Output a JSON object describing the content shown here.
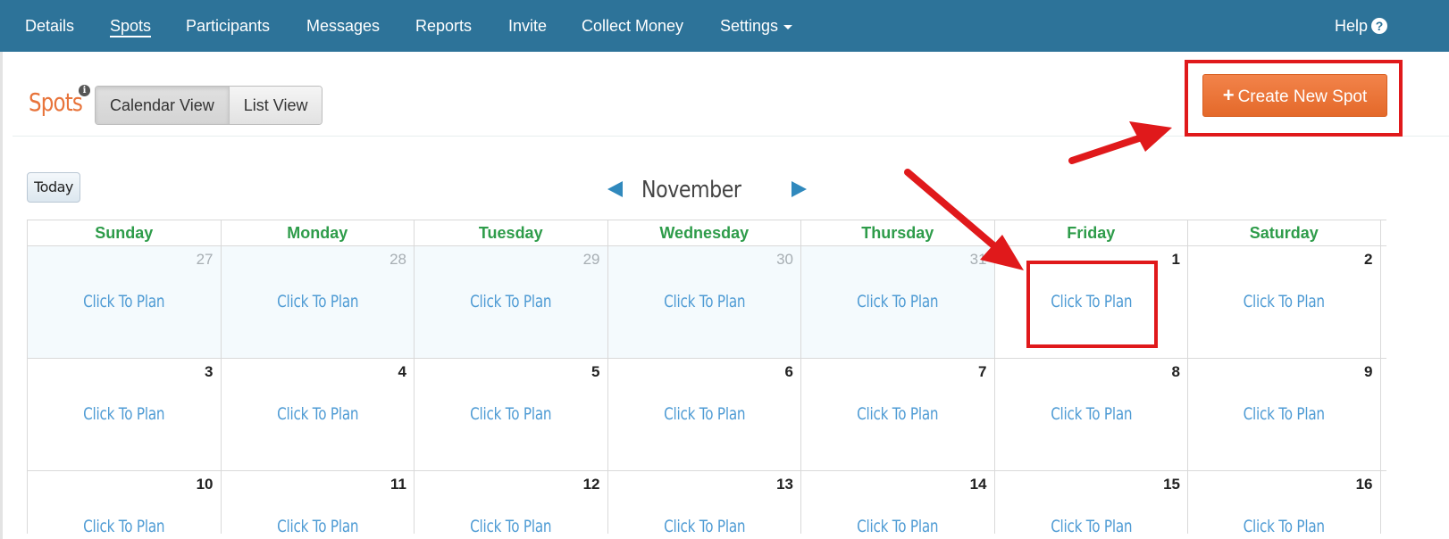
{
  "nav": {
    "items": [
      {
        "label": "Details",
        "active": false
      },
      {
        "label": "Spots",
        "active": true
      },
      {
        "label": "Participants",
        "active": false
      },
      {
        "label": "Messages",
        "active": false
      },
      {
        "label": "Reports",
        "active": false
      },
      {
        "label": "Invite",
        "active": false
      },
      {
        "label": "Collect Money",
        "active": false
      },
      {
        "label": "Settings",
        "active": false
      }
    ],
    "help_label": "Help",
    "help_icon": "question-circle-icon",
    "color": "#2d7399"
  },
  "header": {
    "title": "Spots",
    "info_icon": "info-icon",
    "view_toggle": {
      "calendar_label": "Calendar View",
      "list_label": "List View",
      "selected": "Calendar View"
    },
    "create_button": {
      "label": "Create New Spot",
      "color": "#e8743b"
    }
  },
  "calendar": {
    "today_label": "Today",
    "month": "November",
    "weekdays": [
      "Sunday",
      "Monday",
      "Tuesday",
      "Wednesday",
      "Thursday",
      "Friday",
      "Saturday"
    ],
    "cell_link_label": "Click To Plan",
    "weeks": [
      [
        {
          "day": "27",
          "other": true
        },
        {
          "day": "28",
          "other": true
        },
        {
          "day": "29",
          "other": true
        },
        {
          "day": "30",
          "other": true
        },
        {
          "day": "31",
          "other": true
        },
        {
          "day": "1",
          "other": false
        },
        {
          "day": "2",
          "other": false
        }
      ],
      [
        {
          "day": "3",
          "other": false
        },
        {
          "day": "4",
          "other": false
        },
        {
          "day": "5",
          "other": false
        },
        {
          "day": "6",
          "other": false
        },
        {
          "day": "7",
          "other": false
        },
        {
          "day": "8",
          "other": false
        },
        {
          "day": "9",
          "other": false
        }
      ],
      [
        {
          "day": "10",
          "other": false
        },
        {
          "day": "11",
          "other": false
        },
        {
          "day": "12",
          "other": false
        },
        {
          "day": "13",
          "other": false
        },
        {
          "day": "14",
          "other": false
        },
        {
          "day": "15",
          "other": false
        },
        {
          "day": "16",
          "other": false
        }
      ]
    ],
    "weekday_color": "#2e9c4a",
    "link_color": "#4e9bd4"
  },
  "annotations": {
    "color": "#e0191b"
  }
}
